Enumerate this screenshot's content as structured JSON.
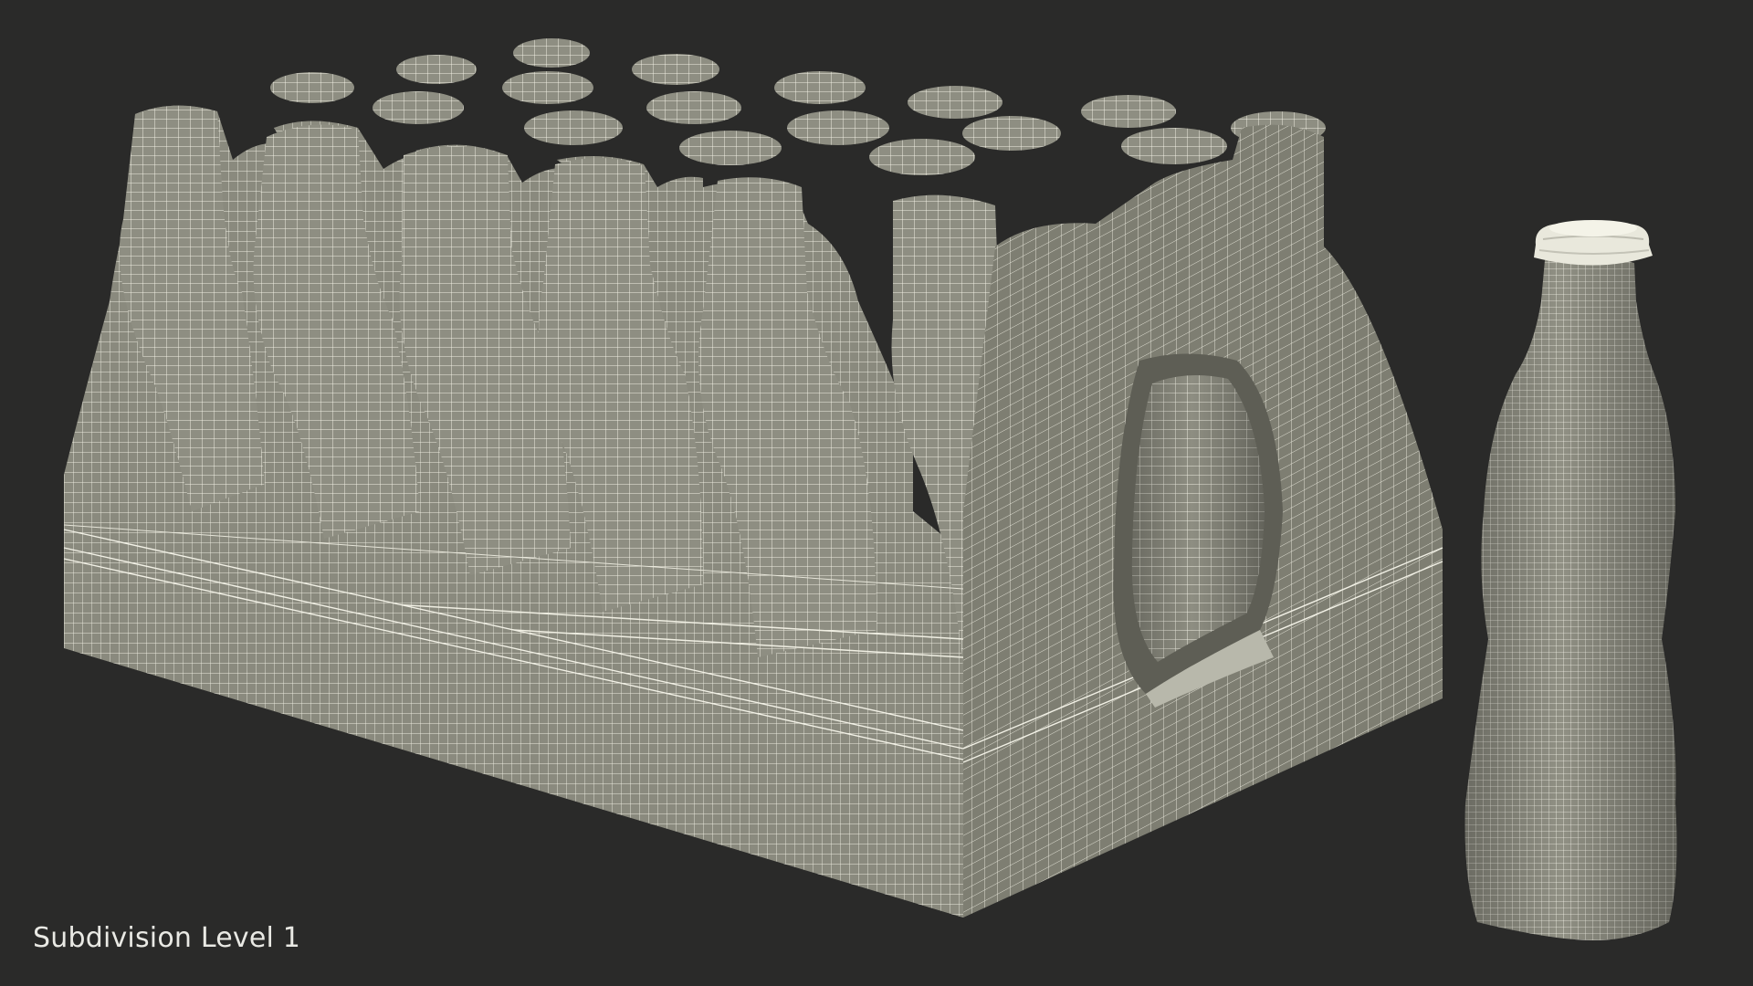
{
  "caption": {
    "text": "Subdivision Level 1"
  },
  "scene": {
    "background_color": "#2a2a29",
    "mesh_fill_color": "#8d8d80",
    "mesh_dark_color": "#6f6f64",
    "wire_color": "#f2f1e6",
    "objects": [
      {
        "name": "bottle-pack-wireframe",
        "description_icon": "bottle-pack-icon"
      },
      {
        "name": "single-bottle-wireframe",
        "description_icon": "bottle-icon"
      }
    ]
  }
}
